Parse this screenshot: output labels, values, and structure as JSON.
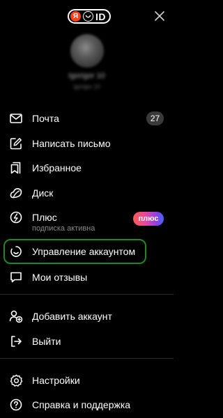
{
  "header": {
    "logo_ya": "Я",
    "logo_id": "ID",
    "close_icon": "close-icon"
  },
  "profile": {
    "name": "Igorigor 10",
    "login": "igorigor 10"
  },
  "menu": {
    "mail": {
      "label": "Почта",
      "icon": "mail-icon",
      "count": "27"
    },
    "compose": {
      "label": "Написать письмо",
      "icon": "compose-icon"
    },
    "favorites": {
      "label": "Избранное",
      "icon": "bookmark-icon"
    },
    "disk": {
      "label": "Диск",
      "icon": "disk-icon"
    },
    "plus": {
      "label": "Плюс",
      "sublabel": "подписка активна",
      "badge": "плюс",
      "icon": "plus-icon"
    },
    "account": {
      "label": "Управление аккаунтом",
      "icon": "account-icon"
    },
    "reviews": {
      "label": "Мои отзывы",
      "icon": "reviews-icon"
    },
    "add_account": {
      "label": "Добавить аккаунт",
      "icon": "add-account-icon"
    },
    "logout": {
      "label": "Выйти",
      "icon": "logout-icon"
    },
    "settings": {
      "label": "Настройки",
      "icon": "settings-icon"
    },
    "help": {
      "label": "Справка и поддержка",
      "icon": "help-icon"
    }
  },
  "colors": {
    "background": "#000000",
    "text": "#ffffff",
    "highlight_border": "#1e8a1e",
    "badge_bg": "#3a3a3a",
    "ya_red": "#fc3f1d"
  }
}
